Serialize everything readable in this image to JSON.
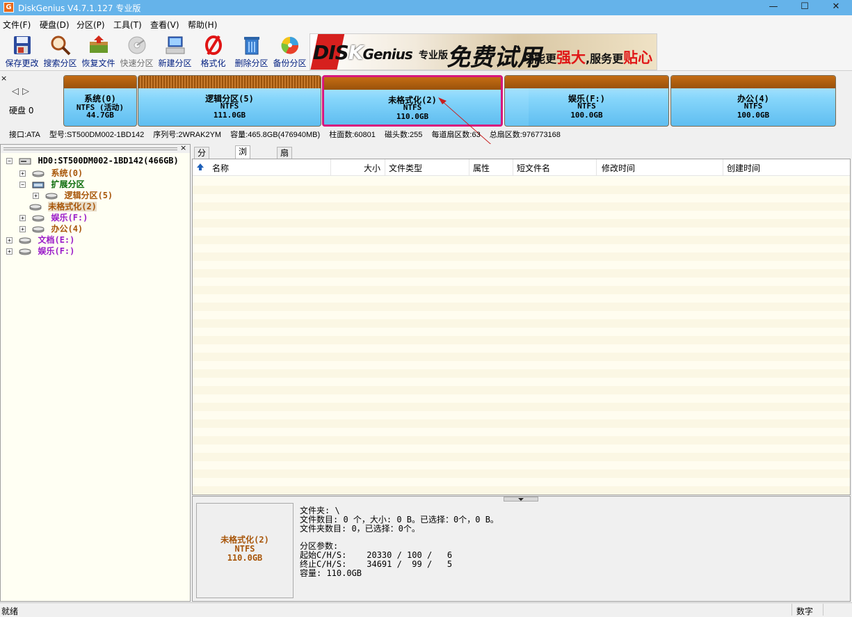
{
  "window": {
    "title": "DiskGenius V4.7.1.127 专业版",
    "logo": "G",
    "controls": {
      "minimize": "—",
      "maximize": "☐",
      "close": "✕"
    }
  },
  "menu": [
    "文件(F)",
    "硬盘(D)",
    "分区(P)",
    "工具(T)",
    "查看(V)",
    "帮助(H)"
  ],
  "toolbar": [
    {
      "label": "保存更改",
      "icon": "save-icon",
      "enabled": true
    },
    {
      "label": "搜索分区",
      "icon": "search-icon",
      "enabled": true
    },
    {
      "label": "恢复文件",
      "icon": "recover-icon",
      "enabled": true
    },
    {
      "label": "快速分区",
      "icon": "quick-partition-icon",
      "enabled": false
    },
    {
      "label": "新建分区",
      "icon": "new-partition-icon",
      "enabled": true
    },
    {
      "label": "格式化",
      "icon": "format-icon",
      "enabled": true
    },
    {
      "label": "删除分区",
      "icon": "delete-icon",
      "enabled": true
    },
    {
      "label": "备份分区",
      "icon": "backup-icon",
      "enabled": true
    }
  ],
  "banner": {
    "brand_di": "DI",
    "brand_s": "S",
    "brand_k": "K",
    "brand_genius": "Genius",
    "edition": "专业版",
    "free": "免费试用",
    "slogan_a": "功能更",
    "slogan_b": "强大",
    "slogan_c": ",服务更",
    "slogan_d": "贴心"
  },
  "disk_panel": {
    "close": "×",
    "nav_prev": "◁",
    "nav_next": "▷",
    "disk_label": "硬盘 0",
    "partitions": [
      {
        "name": "系统(0)",
        "fs": "NTFS (活动)",
        "size": "44.7GB",
        "selected": false
      },
      {
        "name": "逻辑分区(5)",
        "fs": "NTFS",
        "size": "111.0GB",
        "selected": false
      },
      {
        "name": "未格式化(2)",
        "fs": "NTFS",
        "size": "110.0GB",
        "selected": true
      },
      {
        "name": "娱乐(F:)",
        "fs": "NTFS",
        "size": "100.0GB",
        "selected": false
      },
      {
        "name": "办公(4)",
        "fs": "NTFS",
        "size": "100.0GB",
        "selected": false
      }
    ],
    "info": [
      "接口:ATA",
      "型号:ST500DM002-1BD142",
      "序列号:2WRAK2YM",
      "容量:465.8GB(476940MB)",
      "柱面数:60801",
      "磁头数:255",
      "每道扇区数:63",
      "总扇区数:976773168"
    ]
  },
  "tree": {
    "close": "×",
    "nodes": [
      {
        "label": "HD0:ST500DM002-1BD142(466GB)",
        "exp": "−",
        "color": "black",
        "icon": "disk-icon"
      },
      {
        "label": "系统(0)",
        "exp": "+",
        "color": "orange",
        "icon": "partition-icon"
      },
      {
        "label": "扩展分区",
        "exp": "−",
        "color": "green",
        "icon": "extended-partition-icon"
      },
      {
        "label": "逻辑分区(5)",
        "exp": "+",
        "color": "orange",
        "icon": "partition-icon"
      },
      {
        "label": "未格式化(2)",
        "exp": "",
        "color": "orange",
        "icon": "partition-icon"
      },
      {
        "label": "娱乐(F:)",
        "exp": "+",
        "color": "purple",
        "icon": "partition-icon"
      },
      {
        "label": "办公(4)",
        "exp": "+",
        "color": "orange",
        "icon": "partition-icon"
      },
      {
        "label": "文档(E:)",
        "exp": "+",
        "color": "purple",
        "icon": "partition-icon"
      },
      {
        "label": "娱乐(F:)",
        "exp": "+",
        "color": "purple",
        "icon": "partition-icon"
      }
    ]
  },
  "tabs": [
    "分区参数",
    "浏览文件",
    "扇区编辑"
  ],
  "active_tab": "浏览文件",
  "columns": [
    "名称",
    "大小",
    "文件类型",
    "属性",
    "短文件名",
    "修改时间",
    "创建时间"
  ],
  "details": {
    "partition_name": "未格式化(2)",
    "fs": "NTFS",
    "size": "110.0GB",
    "lines": "文件夹: \\\n文件数目: 0 个，大小: 0 B。已选择：0个，0 B。\n文件夹数目: 0，已选择：0个。\n\n分区参数:\n起始C/H/S:    20330 / 100 /   6\n终止C/H/S:    34691 /  99 /   5\n容量: 110.0GB"
  },
  "status": {
    "text": "就绪",
    "mode": "数字"
  },
  "colors": {
    "title_bar": "#65b3ea",
    "selected_border": "#d8177e",
    "partition_cap": "#9a520a"
  }
}
